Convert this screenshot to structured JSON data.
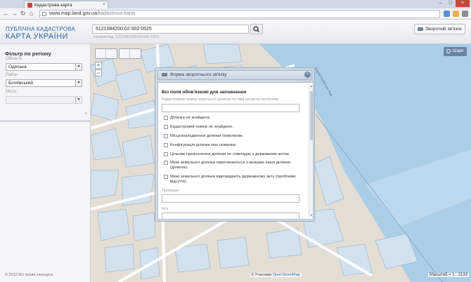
{
  "browser": {
    "tab_title": "Кадастрова карта",
    "url_host": "www.map.land.gov.ua",
    "url_path": "/kadastrova-karta"
  },
  "header": {
    "brand_line1": "ПУБЛІЧНА КАДАСТРОВА",
    "brand_line2": "КАРТА УКРАЇНИ",
    "search_value": "5121084200:02:002:0525",
    "search_hint": "Наприклад: 1221880100:01:047:0001",
    "feedback_label": "Зворотній зв'язок"
  },
  "sidebar": {
    "title": "Фільтр по регіону",
    "region_label": "Область",
    "region_value": "Одеська",
    "district_label": "Район",
    "district_value": "Біляївський",
    "city_label": "Місто",
    "city_value": "",
    "collapse_glyph": "«",
    "copyright": "© 2012 Всі права захищені"
  },
  "map": {
    "layers_label": "Шари",
    "zoom_in": "+",
    "zoom_out": "−",
    "attribution_prefix": "© Учасники",
    "attribution_link": "OpenStreetMap",
    "scale_label": "Масштаб = 1 : 2133",
    "river_label": "Коростишівське вод."
  },
  "modal": {
    "title": "Форма зворотнього зв'язку",
    "close_glyph": "×",
    "required_note": "Всі поля обов'язкові для заповнення",
    "cadastral_label": "Кадастровий номер земельної ділянки по якій виникла проблема",
    "checkboxes": [
      "Ділянка не знайдена.",
      "Кадастровий номер не знайдено.",
      "Місцезнаходження ділянки помилкове.",
      "Конфігурація ділянки має помилки.",
      "Цільове призначення ділянки не співпадає з державним актом.",
      "Межі земельної ділянки перетинаються з межами іншої ділянки (ділянок).",
      "Межі земельної ділянки відповідають державному акту (проблеми відсутні)."
    ],
    "surname_label": "Прізвище",
    "name_label": "Ім'я"
  },
  "colors": {
    "brand_blue": "#2b67a8",
    "water": "#aacde8",
    "parcel_fill": "#d2e1ee",
    "land": "#e4ddd4"
  }
}
